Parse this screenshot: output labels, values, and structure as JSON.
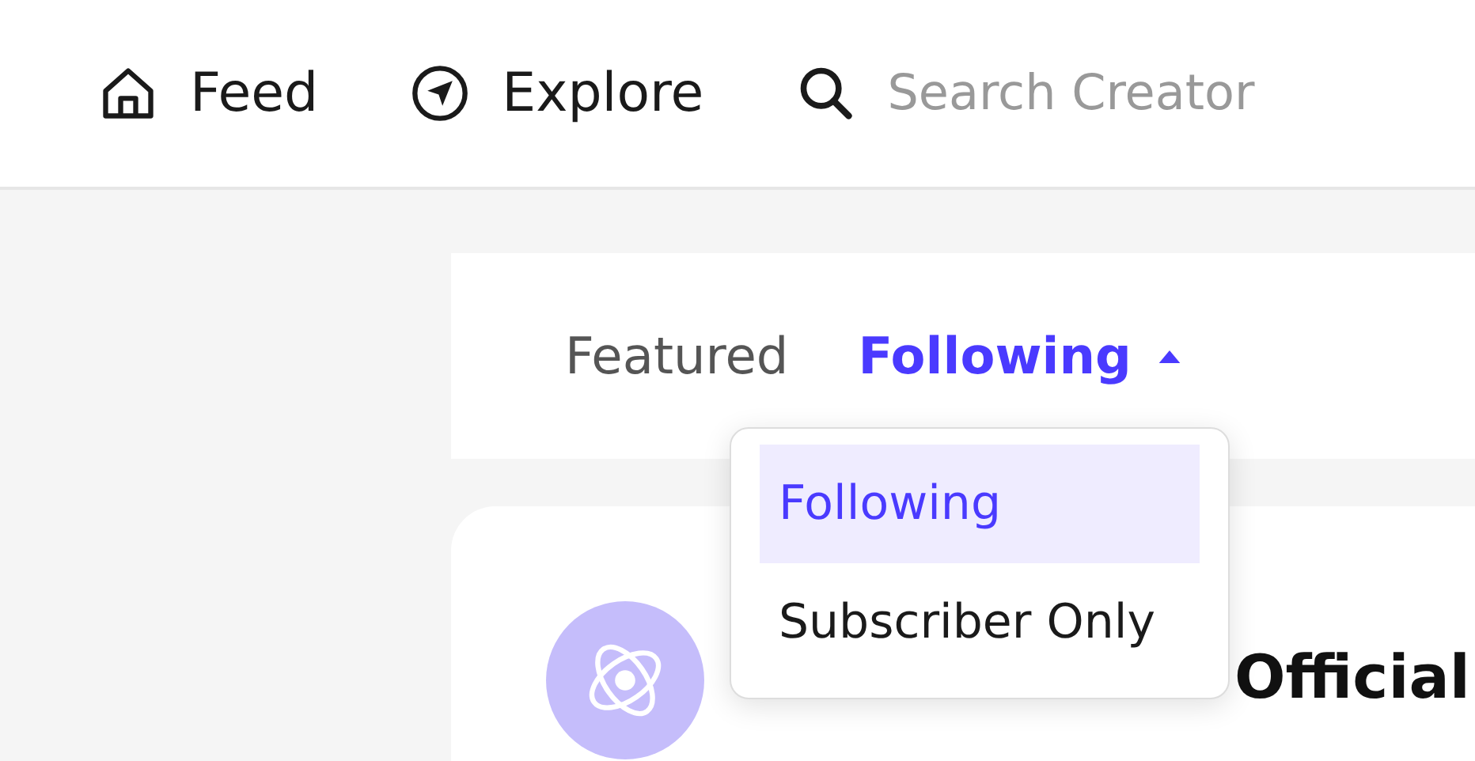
{
  "nav": {
    "items": [
      {
        "kind": "home",
        "label": "Feed"
      },
      {
        "kind": "explore",
        "label": "Explore"
      }
    ],
    "search": {
      "placeholder": "Search Creator"
    }
  },
  "tabs": [
    {
      "label": "Featured",
      "selected": false
    },
    {
      "label": "Following",
      "selected": true
    }
  ],
  "dropdown": {
    "expanded": true,
    "options": [
      {
        "label": "Following",
        "selected": true
      },
      {
        "label": "Subscriber Only",
        "selected": false
      }
    ]
  },
  "post": {
    "creator_name": "Official"
  }
}
